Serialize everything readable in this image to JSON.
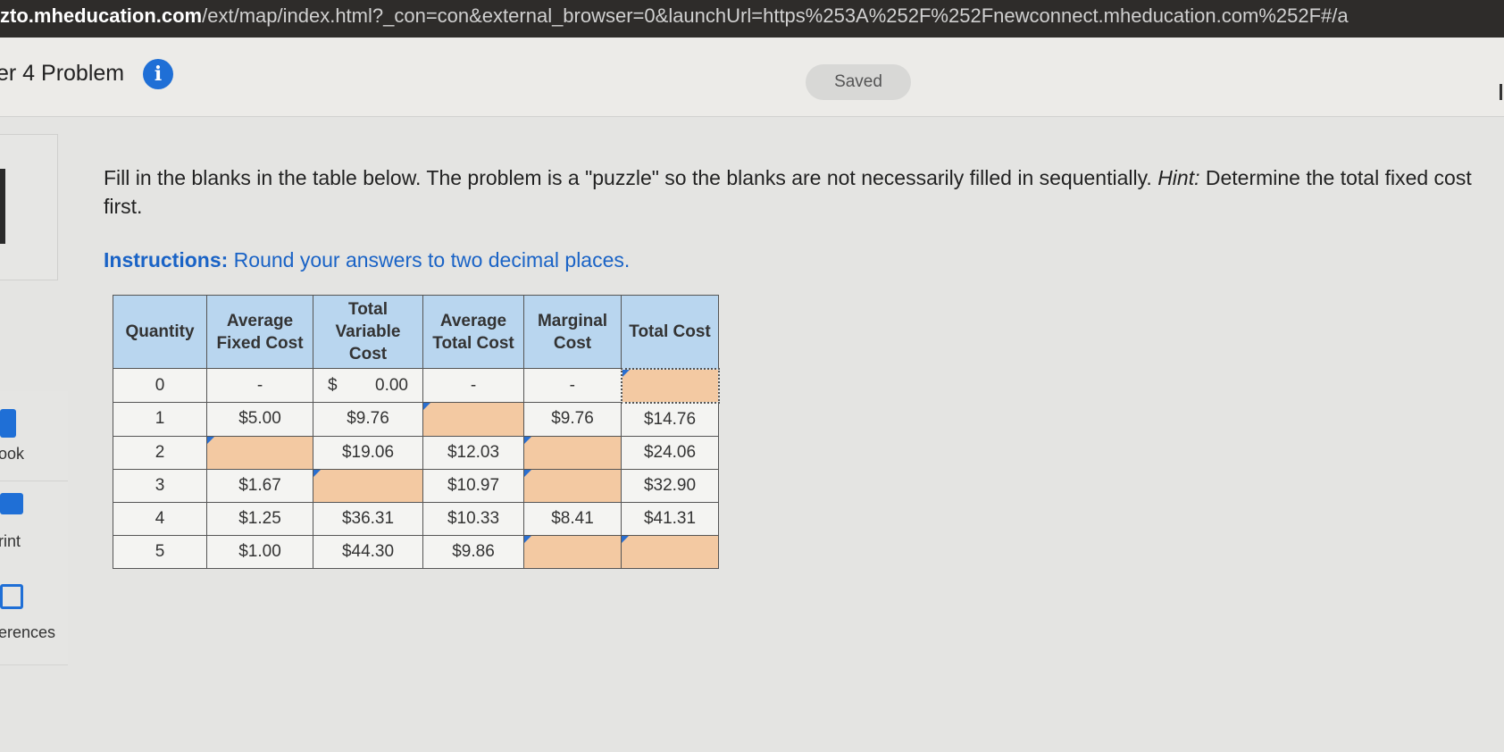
{
  "browser": {
    "url_host": "zto.mheducation.com",
    "url_rest": "/ext/map/index.html?_con=con&external_browser=0&launchUrl=https%253A%252F%252Fnewconnect.mheducation.com%252F#/a"
  },
  "header": {
    "title": "er 4 Problem",
    "info_icon": "info-icon",
    "saved_label": "Saved"
  },
  "sidebar": {
    "items": [
      {
        "label": "ook",
        "icon": "book-icon"
      },
      {
        "label": "rint",
        "icon": "print-icon"
      },
      {
        "label": "erences",
        "icon": "references-icon"
      }
    ]
  },
  "problem": {
    "prompt_main": "Fill in the blanks in the table below. The problem is a \"puzzle\" so the blanks are not necessarily filled in sequentially. ",
    "prompt_hint_label": "Hint:",
    "prompt_hint_text": " Determine the total fixed cost first.",
    "instructions_label": "Instructions:",
    "instructions_text": " Round your answers to two decimal places."
  },
  "table": {
    "headers": {
      "quantity": "Quantity",
      "afc": "Average Fixed Cost",
      "tvc": "Total Variable Cost",
      "atc": "Average Total Cost",
      "mc": "Marginal Cost",
      "tc": "Total Cost"
    },
    "rows": [
      {
        "q": "0",
        "afc": "-",
        "tvc_symbol": "$",
        "tvc_value": "0.00",
        "atc": "-",
        "mc": "-",
        "tc": ""
      },
      {
        "q": "1",
        "afc": "$5.00",
        "tvc": "$9.76",
        "atc": "",
        "mc": "$9.76",
        "tc": "$14.76"
      },
      {
        "q": "2",
        "afc": "",
        "tvc": "$19.06",
        "atc": "$12.03",
        "mc": "",
        "tc": "$24.06"
      },
      {
        "q": "3",
        "afc": "$1.67",
        "tvc": "",
        "atc": "$10.97",
        "mc": "",
        "tc": "$32.90"
      },
      {
        "q": "4",
        "afc": "$1.25",
        "tvc": "$36.31",
        "atc": "$10.33",
        "mc": "$8.41",
        "tc": "$41.31"
      },
      {
        "q": "5",
        "afc": "$1.00",
        "tvc": "$44.30",
        "atc": "$9.86",
        "mc": "",
        "tc": ""
      }
    ]
  },
  "colors": {
    "blank_input": "#f3c9a2",
    "header_bg": "#b9d6ef",
    "accent_blue": "#1f6fd6"
  }
}
